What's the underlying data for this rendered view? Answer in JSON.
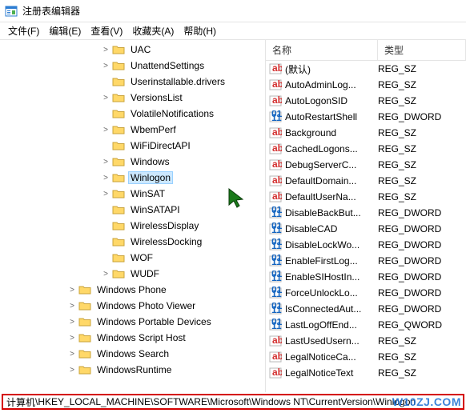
{
  "window": {
    "title": "注册表编辑器"
  },
  "menubar": {
    "file": "文件(F)",
    "edit": "编辑(E)",
    "view": "查看(V)",
    "fav": "收藏夹(A)",
    "help": "帮助(H)"
  },
  "tree": {
    "items": [
      {
        "indent": 9,
        "exp": ">",
        "label": "UAC"
      },
      {
        "indent": 9,
        "exp": ">",
        "label": "UnattendSettings"
      },
      {
        "indent": 9,
        "exp": "",
        "label": "Userinstallable.drivers"
      },
      {
        "indent": 9,
        "exp": ">",
        "label": "VersionsList"
      },
      {
        "indent": 9,
        "exp": "",
        "label": "VolatileNotifications"
      },
      {
        "indent": 9,
        "exp": ">",
        "label": "WbemPerf"
      },
      {
        "indent": 9,
        "exp": "",
        "label": "WiFiDirectAPI"
      },
      {
        "indent": 9,
        "exp": ">",
        "label": "Windows"
      },
      {
        "indent": 9,
        "exp": ">",
        "label": "Winlogon",
        "selected": true
      },
      {
        "indent": 9,
        "exp": ">",
        "label": "WinSAT"
      },
      {
        "indent": 9,
        "exp": "",
        "label": "WinSATAPI"
      },
      {
        "indent": 9,
        "exp": "",
        "label": "WirelessDisplay"
      },
      {
        "indent": 9,
        "exp": "",
        "label": "WirelessDocking"
      },
      {
        "indent": 9,
        "exp": "",
        "label": "WOF"
      },
      {
        "indent": 9,
        "exp": ">",
        "label": "WUDF"
      },
      {
        "indent": 6,
        "exp": ">",
        "label": "Windows Phone"
      },
      {
        "indent": 6,
        "exp": ">",
        "label": "Windows Photo Viewer"
      },
      {
        "indent": 6,
        "exp": ">",
        "label": "Windows Portable Devices"
      },
      {
        "indent": 6,
        "exp": ">",
        "label": "Windows Script Host"
      },
      {
        "indent": 6,
        "exp": ">",
        "label": "Windows Search"
      },
      {
        "indent": 6,
        "exp": ">",
        "label": "WindowsRuntime"
      }
    ]
  },
  "list": {
    "headers": {
      "name": "名称",
      "type": "类型"
    },
    "rows": [
      {
        "icon": "sz",
        "name": "(默认)",
        "type": "REG_SZ"
      },
      {
        "icon": "sz",
        "name": "AutoAdminLog...",
        "type": "REG_SZ"
      },
      {
        "icon": "sz",
        "name": "AutoLogonSID",
        "type": "REG_SZ"
      },
      {
        "icon": "dw",
        "name": "AutoRestartShell",
        "type": "REG_DWORD"
      },
      {
        "icon": "sz",
        "name": "Background",
        "type": "REG_SZ"
      },
      {
        "icon": "sz",
        "name": "CachedLogons...",
        "type": "REG_SZ"
      },
      {
        "icon": "sz",
        "name": "DebugServerC...",
        "type": "REG_SZ"
      },
      {
        "icon": "sz",
        "name": "DefaultDomain...",
        "type": "REG_SZ"
      },
      {
        "icon": "sz",
        "name": "DefaultUserNa...",
        "type": "REG_SZ"
      },
      {
        "icon": "dw",
        "name": "DisableBackBut...",
        "type": "REG_DWORD"
      },
      {
        "icon": "dw",
        "name": "DisableCAD",
        "type": "REG_DWORD"
      },
      {
        "icon": "dw",
        "name": "DisableLockWo...",
        "type": "REG_DWORD"
      },
      {
        "icon": "dw",
        "name": "EnableFirstLog...",
        "type": "REG_DWORD"
      },
      {
        "icon": "dw",
        "name": "EnableSIHostIn...",
        "type": "REG_DWORD"
      },
      {
        "icon": "dw",
        "name": "ForceUnlockLo...",
        "type": "REG_DWORD"
      },
      {
        "icon": "dw",
        "name": "IsConnectedAut...",
        "type": "REG_DWORD"
      },
      {
        "icon": "dw",
        "name": "LastLogOffEnd...",
        "type": "REG_QWORD"
      },
      {
        "icon": "sz",
        "name": "LastUsedUsern...",
        "type": "REG_SZ"
      },
      {
        "icon": "sz",
        "name": "LegalNoticeCa...",
        "type": "REG_SZ"
      },
      {
        "icon": "sz",
        "name": "LegalNoticeText",
        "type": "REG_SZ"
      }
    ]
  },
  "statusbar": {
    "prefix": "计算机",
    "path": "\\HKEY_LOCAL_MACHINE\\SOFTWARE\\Microsoft\\Windows NT\\CurrentVersion\\Winlogon"
  },
  "watermark": "W10ZJ.COM"
}
